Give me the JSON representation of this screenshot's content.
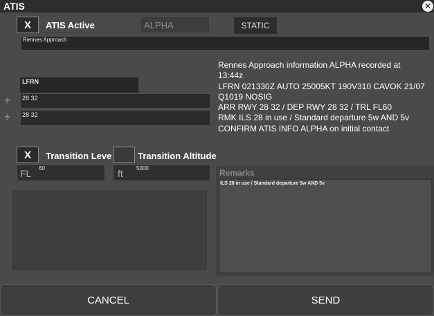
{
  "window": {
    "title": "ATIS"
  },
  "header": {
    "atis_active_checked": "X",
    "atis_active_label": "ATIS Active",
    "letter_value": "ALPHA",
    "static_label": "STATIC",
    "station_name": "Rennes Approach"
  },
  "airport": {
    "icao": "LFRN",
    "arrival_runways": "28 32",
    "departure_runways": "28 32"
  },
  "transition": {
    "level_checked": "X",
    "level_label": "Transition Leve",
    "level_unit": "FL",
    "level_value": "60",
    "altitude_checked": "",
    "altitude_label": "Transition Altitude",
    "altitude_unit": "ft",
    "altitude_value": "5000"
  },
  "atis_text": {
    "lines": [
      "Rennes Approach information ALPHA recorded at",
      "13:44z",
      "LFRN 021330Z AUTO 25005KT 190V310 CAVOK 21/07",
      "Q1019 NOSIG",
      "ARR RWY 28 32 / DEP RWY 28 32 / TRL FL60",
      " RMK ILS 28 in use / Standard departure 5w AND 5v",
      "CONFIRM ATIS INFO ALPHA  on initial contact"
    ]
  },
  "remarks": {
    "title": "Remarks",
    "value": "ILS 28 in use / Standard departure 5w AND 5v"
  },
  "buttons": {
    "cancel": "CANCEL",
    "send": "SEND"
  },
  "colors": {
    "background": "#4a4a4a",
    "titlebar": "#2d2d2d",
    "field_dark": "#2b2b2b"
  }
}
